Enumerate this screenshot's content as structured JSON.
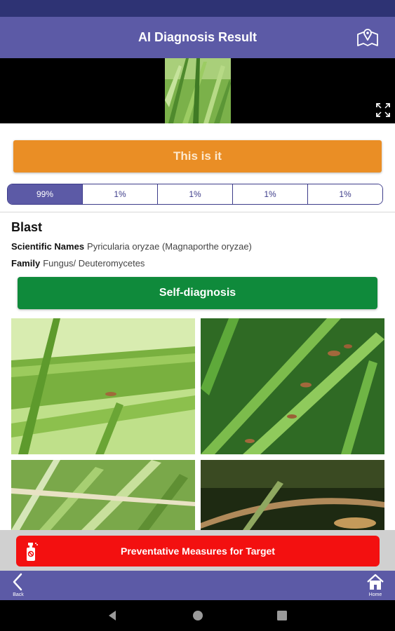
{
  "header": {
    "title": "AI Diagnosis Result",
    "map_icon": "map-pin-icon"
  },
  "photo": {
    "expand_icon": "expand-icon"
  },
  "confirm_label": "This is it",
  "candidates": [
    "99%",
    "1%",
    "1%",
    "1%",
    "1%"
  ],
  "disease": {
    "name": "Blast",
    "scientific_label": "Scientific Names",
    "scientific_value": "Pyricularia oryzae (Magnaporthe oryzae)",
    "family_label": "Family",
    "family_value": "Fungus/ Deuteromycetes"
  },
  "self_diagnosis_label": "Self-diagnosis",
  "preventive_label": "Preventative Measures for Target",
  "bottom_nav": {
    "back": "Back",
    "home": "Home"
  },
  "colors": {
    "app_bar": "#5c5aa6",
    "confirm": "#ea8e25",
    "self_diagnosis": "#0f8a3b",
    "preventive": "#f31010"
  }
}
